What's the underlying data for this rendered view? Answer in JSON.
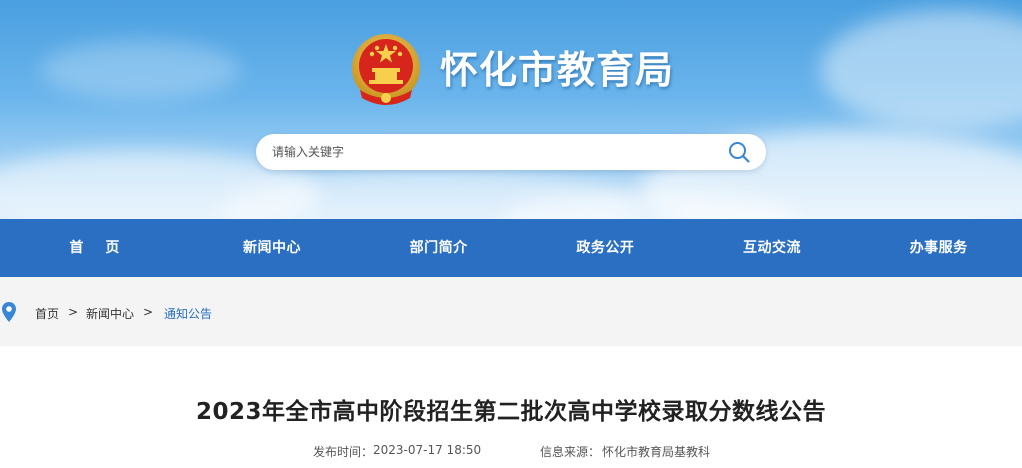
{
  "header": {
    "site_title": "怀化市教育局",
    "emblem_icon": "national-emblem-icon"
  },
  "search": {
    "placeholder": "请输入关键字",
    "icon": "search-icon"
  },
  "nav": {
    "items": [
      {
        "label": "首页"
      },
      {
        "label": "新闻中心"
      },
      {
        "label": "部门简介"
      },
      {
        "label": "政务公开"
      },
      {
        "label": "互动交流"
      },
      {
        "label": "办事服务"
      }
    ]
  },
  "breadcrumb": {
    "icon": "location-pin-icon",
    "items": [
      "首页",
      "新闻中心",
      "通知公告"
    ],
    "separator": ">"
  },
  "article": {
    "title": "2023年全市高中阶段招生第二批次高中学校录取分数线公告",
    "publish_label": "发布时间：",
    "publish_time": "2023-07-17 18:50",
    "source_label": "信息来源：",
    "source": "怀化市教育局基教科"
  },
  "colors": {
    "nav_bg": "#2a6fc1",
    "accent": "#2a6fc1",
    "banner_sky": "#4a9fe0"
  }
}
